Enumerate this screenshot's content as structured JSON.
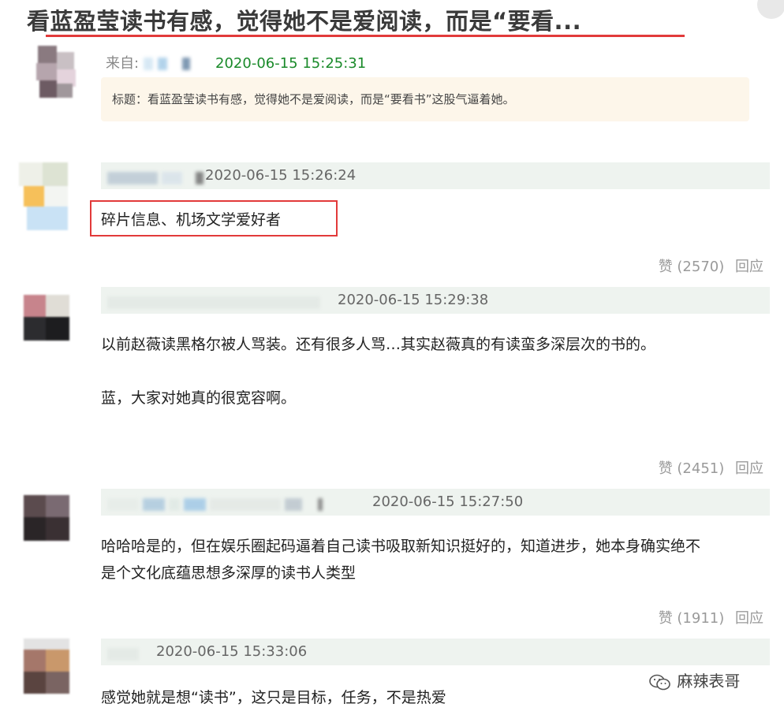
{
  "title": "看蓝盈莹读书有感，觉得她不是爱阅读，而是“要看...",
  "post": {
    "from_label": "来自:",
    "time": "2020-06-15 15:25:31",
    "box_text": "标题：看蓝盈莹读书有感，觉得她不是爱阅读，而是“要看书”这股气逼着她。"
  },
  "comments": [
    {
      "time": "2020-06-15 15:26:24",
      "lines": [
        "碎片信息、机场文学爱好者"
      ],
      "likes": "赞 (2570)",
      "reply": "回应"
    },
    {
      "time": "2020-06-15 15:29:38",
      "lines": [
        "以前赵薇读黑格尔被人骂装。还有很多人骂…其实赵薇真的有读蛮多深层次的书的。",
        "蓝，大家对她真的很宽容啊。"
      ],
      "likes": "赞 (2451)",
      "reply": "回应"
    },
    {
      "time": "2020-06-15 15:27:50",
      "lines": [
        "哈哈哈是的，但在娱乐圈起码逼着自己读书吸取新知识挺好的，知道进步，她本身确实绝不",
        "是个文化底蕴思想多深厚的读书人类型"
      ],
      "likes": "赞 (1911)",
      "reply": "回应"
    },
    {
      "time": "2020-06-15 15:33:06",
      "lines": [
        "感觉她就是想“读书”，这只是目标，任务，不是热爱"
      ]
    }
  ],
  "watermark": "麻辣表哥",
  "colors": {
    "accent_red": "#e23a3a",
    "time_green": "#1a8a2a",
    "meta_bg": "#eef3ef",
    "post_box_bg": "#fdf6ea"
  }
}
